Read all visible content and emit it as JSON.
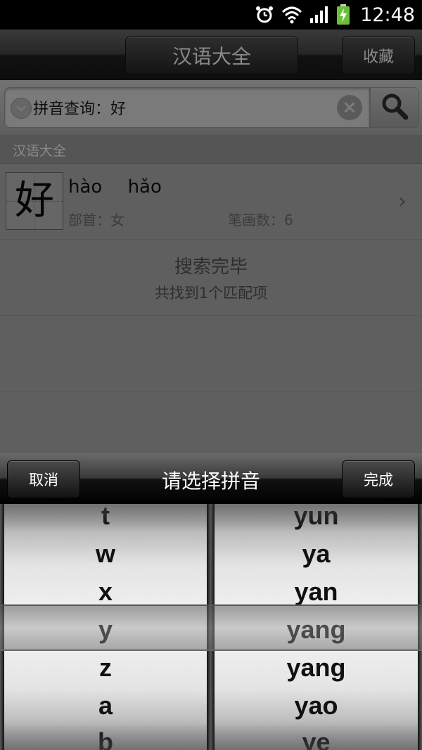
{
  "status": {
    "time": "12:48"
  },
  "header": {
    "title": "汉语大全",
    "favorites_label": "收藏"
  },
  "search": {
    "query": "拼音查询：好"
  },
  "section": {
    "title": "汉语大全"
  },
  "result": {
    "character": "好",
    "pinyin": "hào  hǎo",
    "radical": "部首：女",
    "strokes": "笔画数：6"
  },
  "status_msg": {
    "title": "搜索完毕",
    "subtitle": "共找到1个匹配项"
  },
  "picker": {
    "cancel_label": "取消",
    "title": "请选择拼音",
    "done_label": "完成",
    "left_items": [
      "t",
      "w",
      "x",
      "y",
      "z",
      "a",
      "b"
    ],
    "right_items": [
      "yun",
      "ya",
      "yan",
      "yang",
      "yang",
      "yao",
      "ye"
    ],
    "selected_left": "y",
    "selected_right": "yang"
  }
}
